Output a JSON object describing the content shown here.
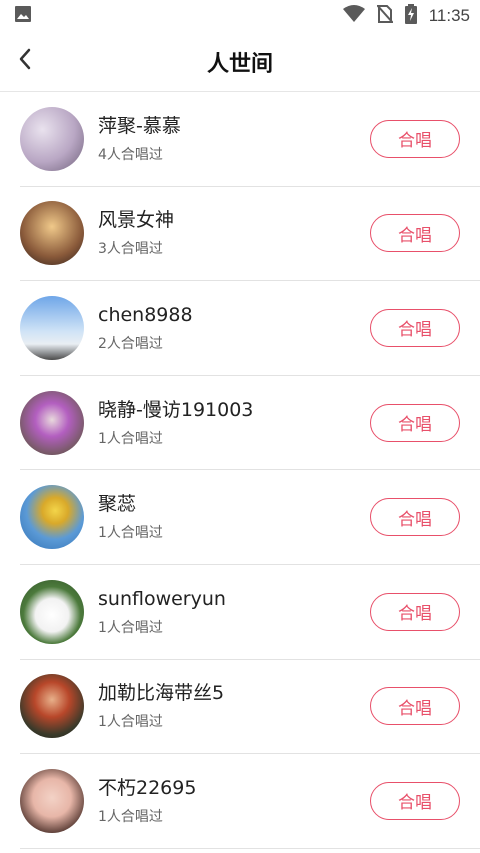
{
  "status": {
    "time": "11:35",
    "icons": [
      "image-icon",
      "wifi-icon",
      "no-sim-icon",
      "battery-charging-icon"
    ]
  },
  "header": {
    "title": "人世间",
    "back_icon": "chevron-left-icon"
  },
  "colors": {
    "accent": "#e8506a"
  },
  "users": [
    {
      "name": "萍聚-慕慕",
      "count": "4人合唱过",
      "button": "合唱"
    },
    {
      "name": "风景女神",
      "count": "3人合唱过",
      "button": "合唱"
    },
    {
      "name": "chen8988",
      "count": "2人合唱过",
      "button": "合唱"
    },
    {
      "name": "晓静-慢访191003",
      "count": "1人合唱过",
      "button": "合唱"
    },
    {
      "name": "聚蕊",
      "count": "1人合唱过",
      "button": "合唱"
    },
    {
      "name": "sunfloweryun",
      "count": "1人合唱过",
      "button": "合唱"
    },
    {
      "name": "加勒比海带丝5",
      "count": "1人合唱过",
      "button": "合唱"
    },
    {
      "name": "不朽22695",
      "count": "1人合唱过",
      "button": "合唱"
    }
  ]
}
